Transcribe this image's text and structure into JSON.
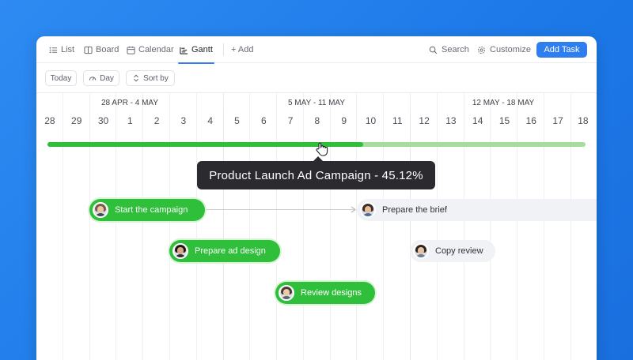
{
  "toolbar": {
    "tabs": [
      {
        "label": "List",
        "icon": "list-icon"
      },
      {
        "label": "Board",
        "icon": "board-icon"
      },
      {
        "label": "Calendar",
        "icon": "calendar-icon"
      },
      {
        "label": "Gantt",
        "icon": "gantt-icon",
        "active": true
      }
    ],
    "add_label": "+ Add",
    "search_label": "Search",
    "customize_label": "Customize",
    "add_task_label": "Add Task"
  },
  "subbar": {
    "today_label": "Today",
    "day_label": "Day",
    "sort_label": "Sort by"
  },
  "timeline": {
    "weeks": [
      "28 APR - 4 MAY",
      "5 MAY - 11 MAY",
      "12 MAY - 18 MAY"
    ],
    "days": [
      "28",
      "29",
      "30",
      "1",
      "2",
      "3",
      "4",
      "5",
      "6",
      "7",
      "8",
      "9",
      "10",
      "11",
      "12",
      "13",
      "14",
      "15",
      "16",
      "17",
      "18"
    ]
  },
  "progress": {
    "project": "Product Launch Ad Campaign",
    "percent": 45.12,
    "tooltip": "Product Launch Ad Campaign - 45.12%"
  },
  "tasks": [
    {
      "label": "Start the campaign",
      "status": "complete"
    },
    {
      "label": "Prepare the brief",
      "status": "open"
    },
    {
      "label": "Prepare ad design",
      "status": "complete"
    },
    {
      "label": "Copy review",
      "status": "open"
    },
    {
      "label": "Review designs",
      "status": "complete"
    }
  ],
  "colors": {
    "accent": "#2f7ef0",
    "progress_done": "#2fbf3a",
    "progress_remaining": "#a6dca0",
    "background": "#1d79e8"
  }
}
